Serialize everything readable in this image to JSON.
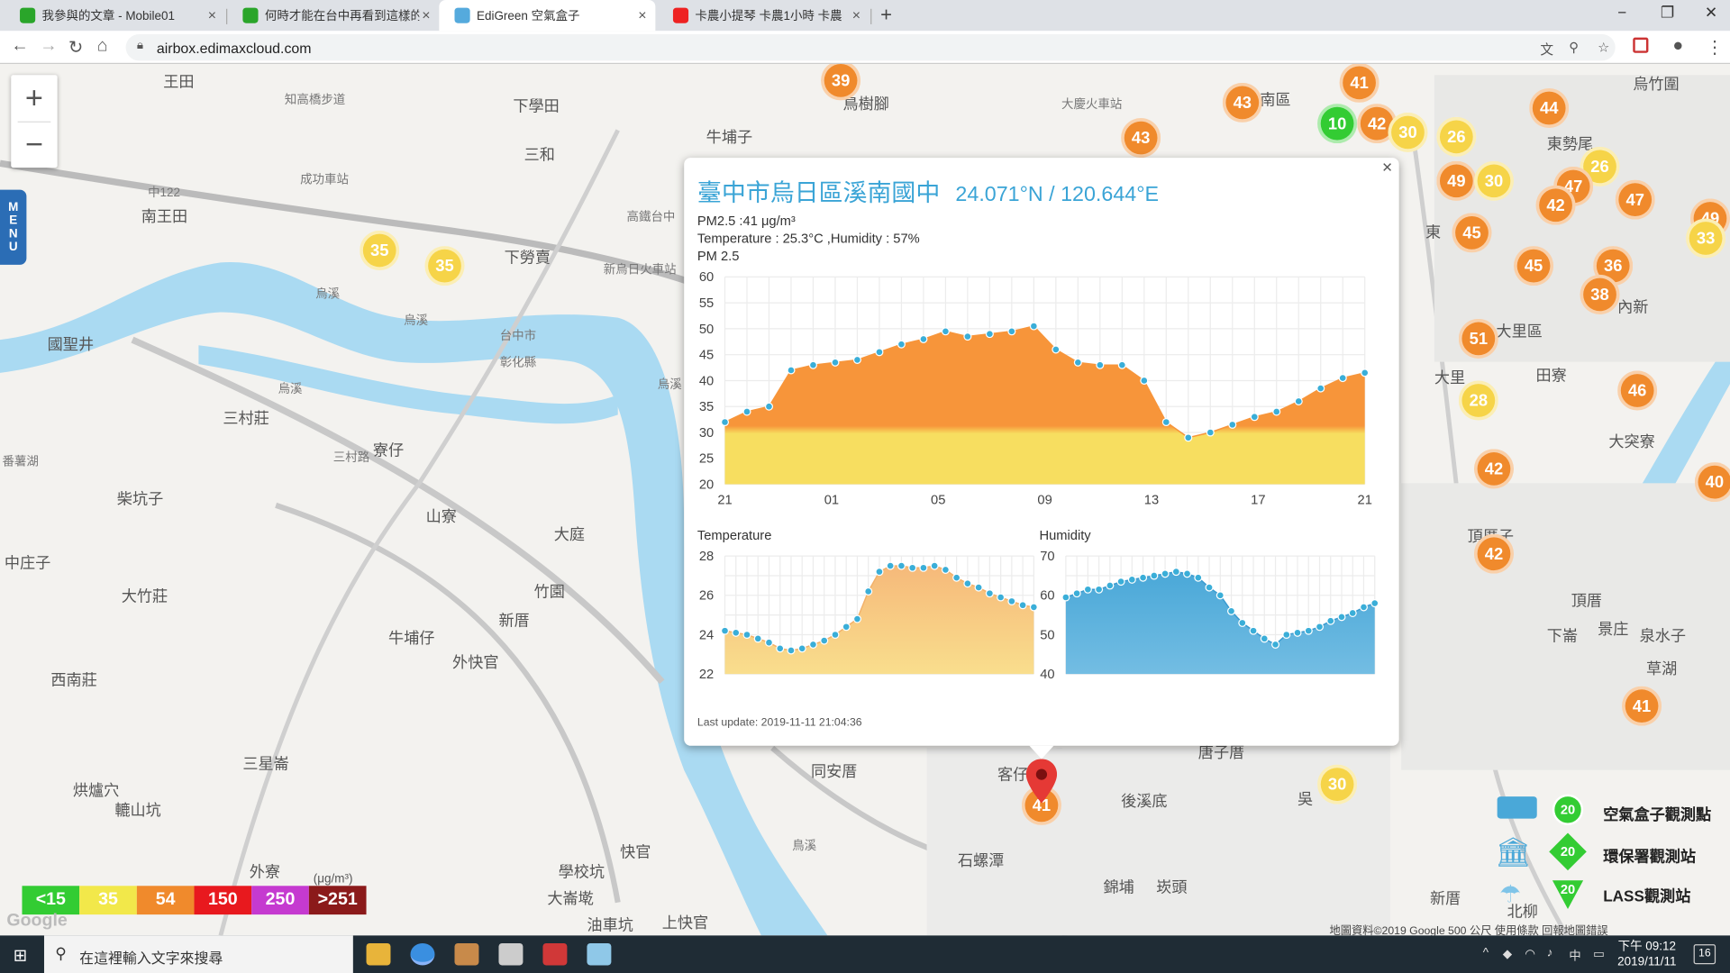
{
  "browser": {
    "tabs": [
      {
        "title": "我參與的文章 - Mobile01",
        "color": "#2aa52a"
      },
      {
        "title": "何時才能在台中再看到這樣的藍天",
        "color": "#2aa52a"
      },
      {
        "title": "EdiGreen 空氣盒子",
        "color": "#55aadd"
      },
      {
        "title": "卡農小提琴 卡農1小時 卡農D",
        "color": "#ee2222"
      }
    ],
    "url": "airbox.edimaxcloud.com"
  },
  "map": {
    "places": [
      {
        "t": "王田"
      },
      {
        "t": "知高橋步道"
      },
      {
        "t": "下學田"
      },
      {
        "t": "三和"
      },
      {
        "t": "成功車站"
      },
      {
        "t": "南王田"
      },
      {
        "t": "中122"
      },
      {
        "t": "下勞賣"
      },
      {
        "t": "新烏日火車站"
      },
      {
        "t": "高鐵台中"
      },
      {
        "t": "國聖井"
      },
      {
        "t": "台中市"
      },
      {
        "t": "彰化縣"
      },
      {
        "t": "三村莊"
      },
      {
        "t": "寮仔"
      },
      {
        "t": "三村路"
      },
      {
        "t": "柴坑子"
      },
      {
        "t": "山寮"
      },
      {
        "t": "大庭"
      },
      {
        "t": "竹園"
      },
      {
        "t": "新厝"
      },
      {
        "t": "中庄子"
      },
      {
        "t": "大竹莊"
      },
      {
        "t": "牛埔仔"
      },
      {
        "t": "外快官"
      },
      {
        "t": "西南莊"
      },
      {
        "t": "三星崙"
      },
      {
        "t": "烘爐穴"
      },
      {
        "t": "轆山坑"
      },
      {
        "t": "同安厝"
      },
      {
        "t": "客仔"
      },
      {
        "t": "後溪底"
      },
      {
        "t": "石螺潭"
      },
      {
        "t": "錦埔"
      },
      {
        "t": "崁頭"
      },
      {
        "t": "學校坑"
      },
      {
        "t": "大崙墘"
      },
      {
        "t": "油車坑"
      },
      {
        "t": "上快官"
      },
      {
        "t": "外寮"
      },
      {
        "t": "快官"
      },
      {
        "t": "烏竹圍"
      },
      {
        "t": "東勢尾"
      },
      {
        "t": "大里區"
      },
      {
        "t": "田寮"
      },
      {
        "t": "大突寮"
      },
      {
        "t": "頂厝子"
      },
      {
        "t": "頂厝"
      },
      {
        "t": "下崙"
      },
      {
        "t": "景庄"
      },
      {
        "t": "泉水子"
      },
      {
        "t": "草湖"
      },
      {
        "t": "大里"
      },
      {
        "t": "內新"
      },
      {
        "t": "南區"
      },
      {
        "t": "東"
      },
      {
        "t": "大慶火車站"
      },
      {
        "t": "牛埔子"
      },
      {
        "t": "烏溪"
      },
      {
        "t": "烏溪"
      },
      {
        "t": "烏溪"
      },
      {
        "t": "烏溪"
      },
      {
        "t": "鳥樹腳"
      },
      {
        "t": "鳥溪"
      },
      {
        "t": "番薯湖"
      },
      {
        "t": "新厝"
      },
      {
        "t": "北柳"
      },
      {
        "t": "唐子厝"
      },
      {
        "t": "吳"
      }
    ],
    "markers": [
      {
        "v": "39",
        "c": "orange"
      },
      {
        "v": "43",
        "c": "orange"
      },
      {
        "v": "43",
        "c": "orange"
      },
      {
        "v": "41",
        "c": "orange"
      },
      {
        "v": "10",
        "c": "green"
      },
      {
        "v": "42",
        "c": "orange"
      },
      {
        "v": "30",
        "c": "yellow"
      },
      {
        "v": "26",
        "c": "yellow"
      },
      {
        "v": "41",
        "c": "orange"
      },
      {
        "v": "44",
        "c": "orange"
      },
      {
        "v": "49",
        "c": "orange"
      },
      {
        "v": "30",
        "c": "yellow"
      },
      {
        "v": "26",
        "c": "yellow"
      },
      {
        "v": "47",
        "c": "orange"
      },
      {
        "v": "42",
        "c": "orange"
      },
      {
        "v": "47",
        "c": "orange"
      },
      {
        "v": "49",
        "c": "orange"
      },
      {
        "v": "33",
        "c": "yellow"
      },
      {
        "v": "45",
        "c": "orange"
      },
      {
        "v": "45",
        "c": "orange"
      },
      {
        "v": "36",
        "c": "orange"
      },
      {
        "v": "38",
        "c": "orange"
      },
      {
        "v": "35",
        "c": "yellow"
      },
      {
        "v": "35",
        "c": "yellow"
      },
      {
        "v": "51",
        "c": "orange"
      },
      {
        "v": "28",
        "c": "yellow"
      },
      {
        "v": "46",
        "c": "orange"
      },
      {
        "v": "42",
        "c": "orange"
      },
      {
        "v": "40",
        "c": "orange"
      },
      {
        "v": "42",
        "c": "orange"
      },
      {
        "v": "41",
        "c": "orange"
      },
      {
        "v": "30",
        "c": "yellow"
      },
      {
        "v": "41",
        "c": "orange"
      }
    ],
    "zoom_in": "+",
    "zoom_out": "−",
    "menu_letters": [
      "M",
      "E",
      "N",
      "U"
    ],
    "copyright": "地圖資料©2019 Google   500 公尺          使用條款   回報地圖錯誤",
    "google_logo": "Google"
  },
  "legend": {
    "unit": "(μg/m³)",
    "levels": [
      {
        "label": "<15",
        "color": "#33cc33"
      },
      {
        "label": "35",
        "color": "#f2e84a"
      },
      {
        "label": "54",
        "color": "#f08a2c"
      },
      {
        "label": "150",
        "color": "#e8191e"
      },
      {
        "label": "250",
        "color": "#c53ad0"
      },
      {
        "label": ">251",
        "color": "#8b1a1a"
      }
    ]
  },
  "station_legend": {
    "items": [
      {
        "label": "空氣盒子觀測點",
        "badge": "20"
      },
      {
        "label": "環保署觀測站",
        "badge": "20"
      },
      {
        "label": "LASS觀測站",
        "badge": "20"
      }
    ]
  },
  "popup": {
    "close": "×",
    "title": "臺中市烏日區溪南國中",
    "coord": "24.071°N / 120.644°E",
    "pm25_line": "PM2.5 :41 μg/m³",
    "weather_line": "Temperature : 25.3°C ,Humidity : 57%",
    "pm_label": "PM 2.5",
    "last_update": "Last update: 2019-11-11 21:04:36"
  },
  "chart_data": [
    {
      "type": "area",
      "title": "PM 2.5",
      "x_ticks": [
        "21",
        "01",
        "05",
        "09",
        "13",
        "17",
        "21"
      ],
      "y_ticks": [
        20,
        25,
        30,
        35,
        40,
        45,
        50,
        55,
        60
      ],
      "ylim": [
        20,
        60
      ],
      "values": [
        32,
        34,
        35,
        42,
        43,
        43.5,
        44,
        45.5,
        47,
        48,
        49.5,
        48.5,
        49,
        49.5,
        50.5,
        46,
        43.5,
        43,
        43,
        40,
        32,
        29,
        30,
        31.5,
        33,
        34,
        36,
        38.5,
        40.5,
        41.5
      ],
      "colors": {
        "high": "#f7953a",
        "low": "#f7de60"
      }
    },
    {
      "type": "area",
      "title": "Temperature",
      "y_ticks": [
        22,
        24,
        26,
        28
      ],
      "ylim": [
        22,
        28
      ],
      "values": [
        24.2,
        24.1,
        24.0,
        23.8,
        23.6,
        23.3,
        23.2,
        23.3,
        23.5,
        23.7,
        24.0,
        24.4,
        24.8,
        26.2,
        27.2,
        27.5,
        27.5,
        27.4,
        27.4,
        27.5,
        27.3,
        26.9,
        26.6,
        26.4,
        26.1,
        25.9,
        25.7,
        25.5,
        25.4
      ],
      "colors": {
        "high": "#f6b97a",
        "low": "#f9de8d"
      }
    },
    {
      "type": "area",
      "title": "Humidity",
      "y_ticks": [
        40,
        50,
        60,
        70
      ],
      "ylim": [
        40,
        70
      ],
      "values": [
        59.5,
        60.5,
        61.5,
        61.5,
        62.5,
        63.5,
        64,
        64.5,
        65,
        65.5,
        66,
        65.5,
        64.5,
        62,
        60,
        56,
        53,
        51,
        49,
        47.5,
        50,
        50.5,
        51,
        52,
        53.5,
        54.5,
        55.5,
        57,
        58
      ],
      "colors": {
        "high": "#4aa8d8",
        "low": "#73bde3"
      }
    }
  ],
  "taskbar": {
    "search_placeholder": "在這裡輸入文字來搜尋",
    "time": "下午 09:12",
    "date": "2019/11/11",
    "ime": "中",
    "notif_count": "16"
  }
}
